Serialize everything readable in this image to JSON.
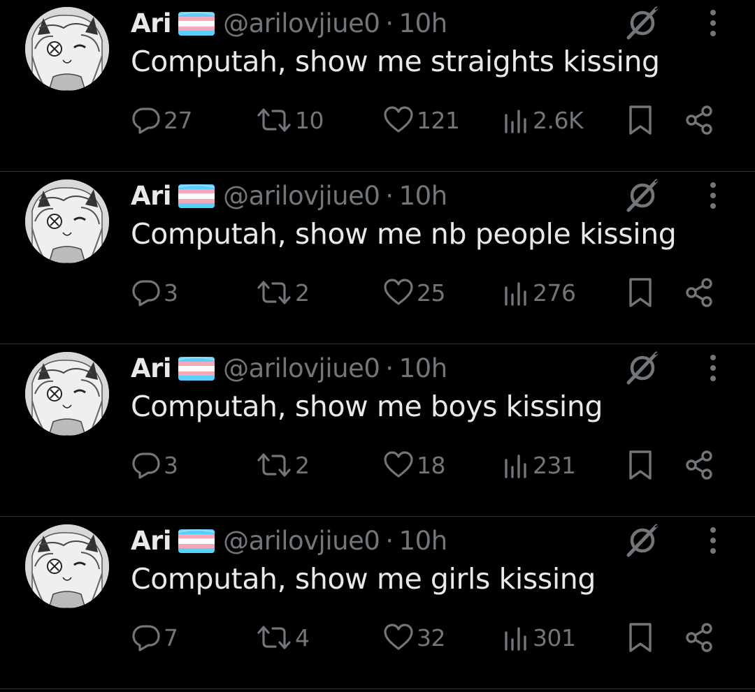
{
  "colors": {
    "background": "#000000",
    "text_primary": "#e7e9ea",
    "text_secondary": "#71767b",
    "divider": "#2f3336",
    "flag_blue": "#5bcefa",
    "flag_pink": "#f5a9b8",
    "flag_white": "#ffffff"
  },
  "tweets": [
    {
      "name": "Ari",
      "flag_icon": "trans-flag-emoji",
      "handle": "@arilovjiue0",
      "separator": "·",
      "time": "10h",
      "text": "Computah, show me straights kissing",
      "replies": "27",
      "retweets": "10",
      "likes": "121",
      "views": "2.6K"
    },
    {
      "name": "Ari",
      "flag_icon": "trans-flag-emoji",
      "handle": "@arilovjiue0",
      "separator": "·",
      "time": "10h",
      "text": "Computah, show me nb people kissing",
      "replies": "3",
      "retweets": "2",
      "likes": "25",
      "views": "276"
    },
    {
      "name": "Ari",
      "flag_icon": "trans-flag-emoji",
      "handle": "@arilovjiue0",
      "separator": "·",
      "time": "10h",
      "text": "Computah, show me boys kissing",
      "replies": "3",
      "retweets": "2",
      "likes": "18",
      "views": "231"
    },
    {
      "name": "Ari",
      "flag_icon": "trans-flag-emoji",
      "handle": "@arilovjiue0",
      "separator": "·",
      "time": "10h",
      "text": "Computah, show me girls kissing",
      "replies": "7",
      "retweets": "4",
      "likes": "32",
      "views": "301"
    }
  ],
  "icons": {
    "grok": "grok-icon",
    "more": "more-vertical-icon",
    "reply": "reply-icon",
    "retweet": "retweet-icon",
    "like": "heart-icon",
    "views": "views-icon",
    "bookmark": "bookmark-icon",
    "share": "share-icon"
  }
}
